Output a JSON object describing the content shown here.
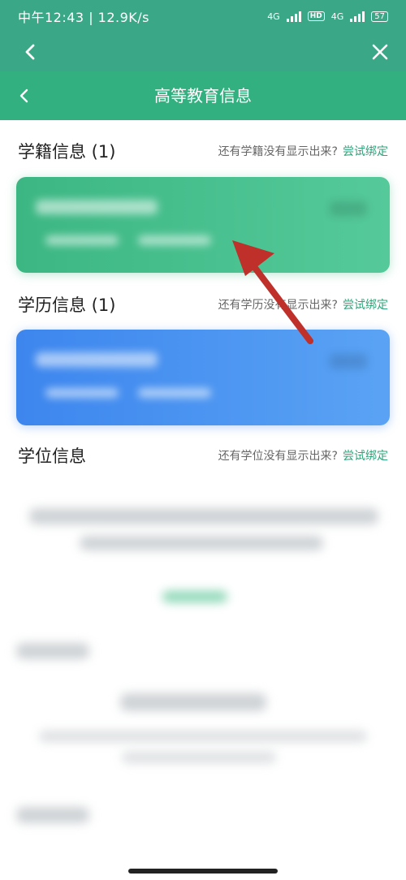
{
  "status_bar": {
    "left": "中午12:43 | 12.9K/s",
    "net1": "4G",
    "hd": "HD",
    "net2": "4G",
    "battery": "57"
  },
  "header": {
    "title": "高等教育信息"
  },
  "sections": [
    {
      "title": "学籍信息 (1)",
      "hint": "还有学籍没有显示出来?",
      "link": "尝试绑定"
    },
    {
      "title": "学历信息 (1)",
      "hint": "还有学历没有显示出来?",
      "link": "尝试绑定"
    },
    {
      "title": "学位信息",
      "hint": "还有学位没有显示出来?",
      "link": "尝试绑定"
    }
  ],
  "colors": {
    "topbar": "#3aa887",
    "header": "#33b07f",
    "link": "#2fa37a",
    "card_green": "#3cb783",
    "card_blue": "#3d86ee",
    "arrow": "#c0302b"
  }
}
